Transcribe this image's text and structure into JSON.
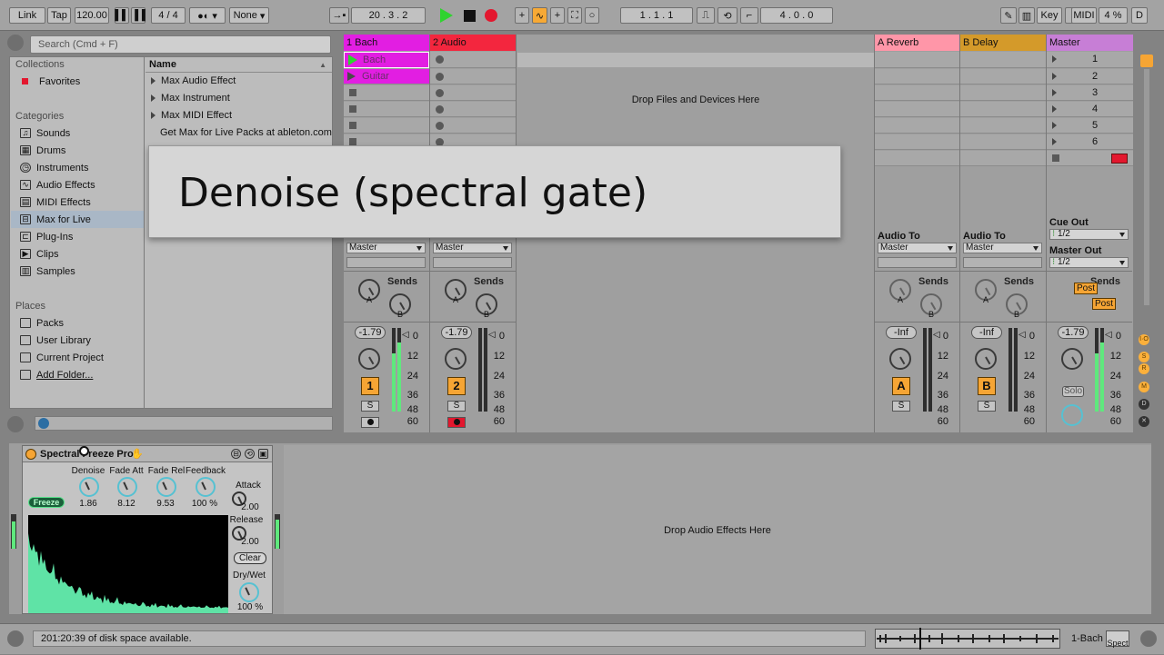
{
  "topbar": {
    "link": "Link",
    "tap": "Tap",
    "bpm": "120.00",
    "metro_icon": "metronome-icon",
    "signature": "4 / 4",
    "quant": "None",
    "position": "20 .  3 .  2",
    "loop_start": "1 .  1 .  1",
    "loop_len": "4 .  0 .  0",
    "key": "Key",
    "midi": "MIDI",
    "cpu": "4 %",
    "d": "D"
  },
  "browser": {
    "search_placeholder": "Search (Cmd + F)",
    "collections_head": "Collections",
    "favorites": "Favorites",
    "categories_head": "Categories",
    "categories": [
      "Sounds",
      "Drums",
      "Instruments",
      "Audio Effects",
      "MIDI Effects",
      "Max for Live",
      "Plug-Ins",
      "Clips",
      "Samples"
    ],
    "places_head": "Places",
    "places": [
      "Packs",
      "User Library",
      "Current Project",
      "Add Folder..."
    ],
    "name_head": "Name",
    "items": [
      "Max Audio Effect",
      "Max Instrument",
      "Max MIDI Effect"
    ],
    "promo": "Get Max for Live Packs at ableton.com"
  },
  "session": {
    "drop_hint": "Drop Files and Devices Here",
    "tracks": [
      {
        "name": "1 Bach",
        "color": "#e21ee2",
        "clips": [
          "Bach",
          "Guitar"
        ],
        "audio_to": "Master",
        "vol": "-1.79",
        "num": "1"
      },
      {
        "name": "2 Audio",
        "color": "#f3263e",
        "clips": [],
        "audio_to": "Master",
        "vol": "-1.79",
        "num": "2"
      },
      {
        "name": "A Reverb",
        "color": "#ff96a8",
        "audio_to_label": "Audio To",
        "audio_to": "Master",
        "vol": "-Inf",
        "num": "A"
      },
      {
        "name": "B Delay",
        "color": "#d49a2a",
        "audio_to_label": "Audio To",
        "audio_to": "Master",
        "vol": "-Inf",
        "num": "B"
      },
      {
        "name": "Master",
        "color": "#c77ed6",
        "scenes": [
          "1",
          "2",
          "3",
          "4",
          "5",
          "6"
        ],
        "vol": "-1.79"
      }
    ],
    "sends": "Sends",
    "send_a": "A",
    "send_b": "B",
    "solo_btn": "S",
    "solo_word": "Solo",
    "cue_out": "Cue Out",
    "cue_val": "1/2",
    "master_out": "Master Out",
    "master_val": "1/2",
    "post": "Post",
    "meter_scale": [
      "0",
      "12",
      "24",
      "36",
      "48",
      "60"
    ]
  },
  "overlay": {
    "title": "Denoise (spectral gate)"
  },
  "device": {
    "title": "Spectral Freeze Pro",
    "knobs": [
      {
        "label": "Denoise",
        "value": "1.86"
      },
      {
        "label": "Fade Att",
        "value": "8.12"
      },
      {
        "label": "Fade Rel",
        "value": "9.53"
      },
      {
        "label": "Feedback",
        "value": "100 %"
      }
    ],
    "attack": "Attack",
    "attack_val": "2.00",
    "release": "Release",
    "release_val": "2.00",
    "freeze": "Freeze",
    "clear": "Clear",
    "drywet": "Dry/Wet",
    "drywet_val": "100 %",
    "drop_hint": "Drop Audio Effects Here"
  },
  "status": {
    "text": "201:20:39 of disk space available.",
    "track": "1-Bach",
    "spect": "Spect"
  }
}
